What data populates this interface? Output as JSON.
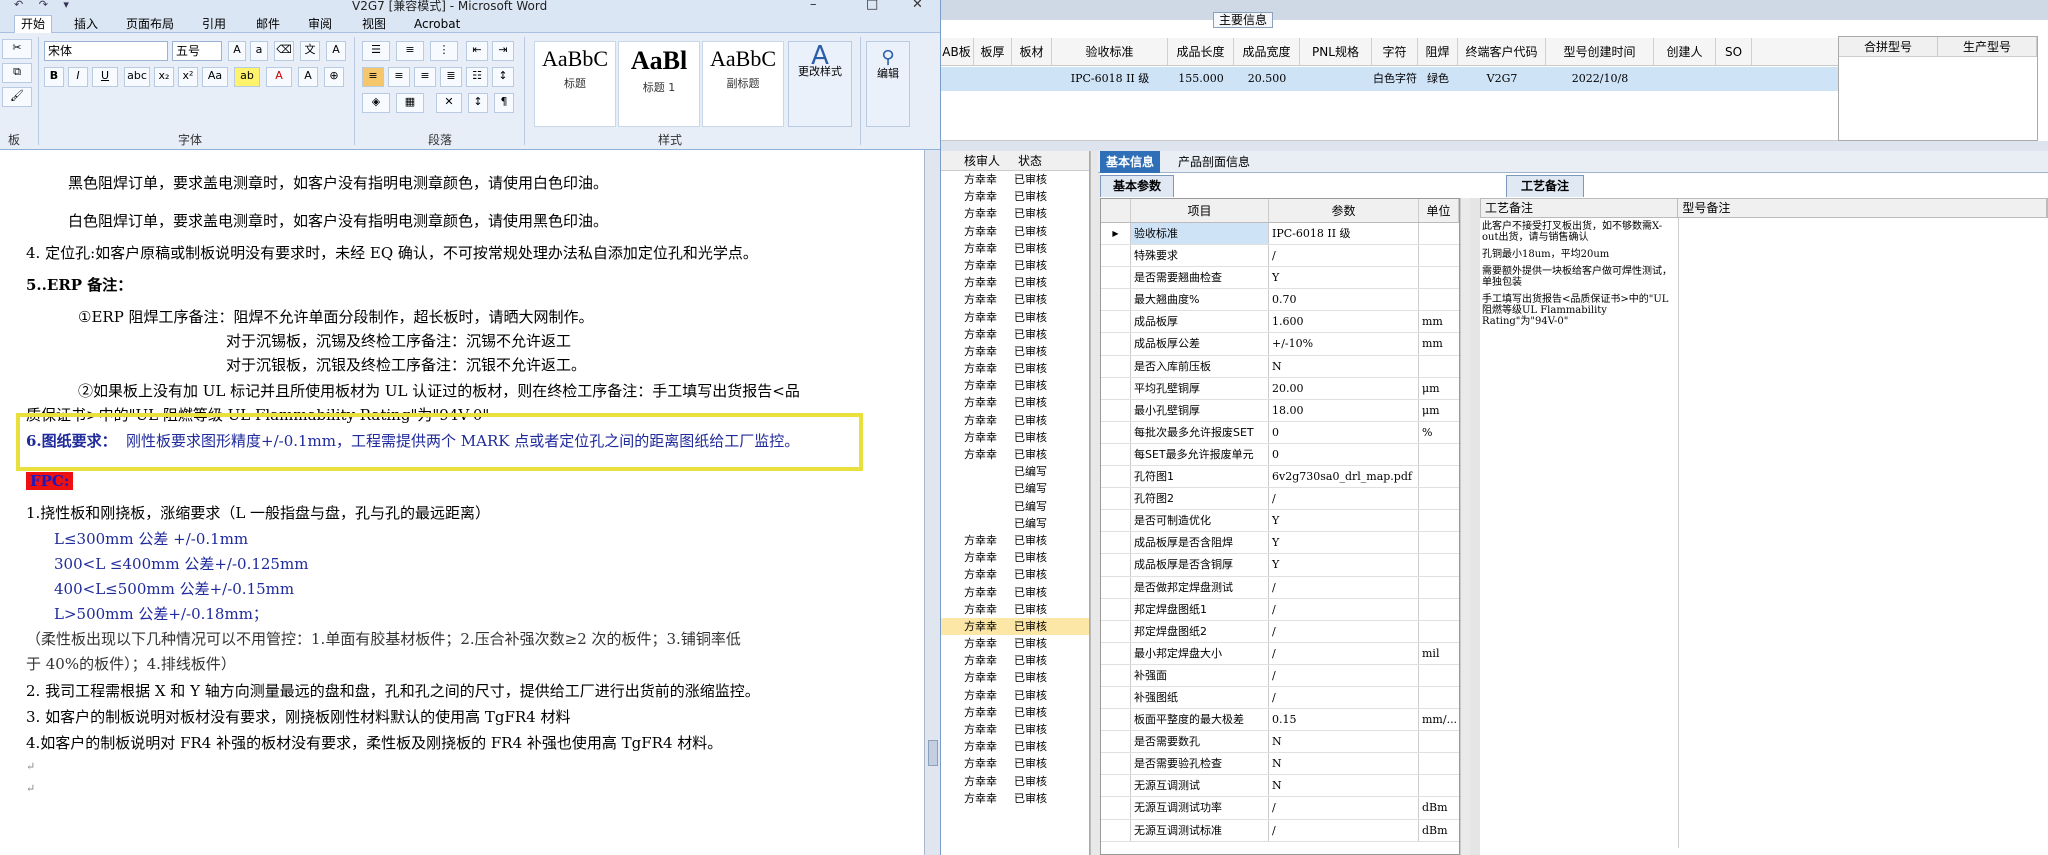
{
  "word": {
    "title": "V2G7 [兼容模式] - Microsoft Word",
    "quick_access": "↶ ↷ ▾",
    "window_controls": [
      "–",
      "□",
      "✕"
    ],
    "tabs": [
      "开始",
      "插入",
      "页面布局",
      "引用",
      "邮件",
      "审阅",
      "视图",
      "Acrobat"
    ],
    "font_name": "宋体",
    "font_size": "五号",
    "groups": [
      "板",
      "字体",
      "段落",
      "样式"
    ],
    "styles": [
      {
        "sample": "AaBbC",
        "name": "标题"
      },
      {
        "sample": "AaBl",
        "name": "标题 1"
      },
      {
        "sample": "AaBbC",
        "name": "副标题"
      }
    ],
    "change_styles": "更改样式",
    "edit": "编辑",
    "lines": [
      "黑色阻焊订单，要求盖电测章时，如客户没有指明电测章颜色，请使用白色印油。",
      "白色阻焊订单，要求盖电测章时，如客户没有指明电测章颜色，请使用黑色印油。",
      "4.  定位孔:如客户原稿或制板说明没有要求时，未经 EQ 确认，不可按常规处理办法私自添加定位孔和光学点。",
      "5..ERP 备注：",
      "①ERP 阻焊工序备注：阻焊不允许单面分段制作，超长板时，请晒大网制作。",
      "对于沉锡板，沉锡及终检工序备注：沉锡不允许返工",
      "对于沉银板，沉银及终检工序备注：沉银不允许返工。",
      "②如果板上没有加 UL 标记并且所使用板材为 UL 认证过的板材，则在终检工序备注：手工填写出货报告<品",
      "质保证书>中的\"UL 阻燃等级 UL Flammability Rating\"为\"94V-0\"",
      "6.图纸要求：",
      "刚性板要求图形精度+/-0.1mm，工程需提供两个 MARK 点或者定位孔之间的距离图纸给工厂监控。",
      "FPC:",
      "1.挠性板和刚挠板，涨缩要求（L 一般指盘与盘，孔与孔的最远距离）",
      "L≤300mm 公差 +/-0.1mm",
      "300<L ≤400mm 公差+/-0.125mm",
      "400<L≤500mm 公差+/-0.15mm",
      "L>500mm 公差+/-0.18mm；",
      "（柔性板出现以下几种情况可以不用管控：1.单面有胶基材板件；2.压合补强次数≥2 次的板件；3.铺铜率低",
      "于 40%的板件）；4.排线板件）",
      "2.   我司工程需根据 X 和 Y 轴方向测量最远的盘和盘，孔和孔之间的尺寸，提供给工厂进行出货前的涨缩监控。",
      "3. 如客户的制板说明对板材没有要求，刚挠板刚性材料默认的使用高 TgFR4 材料",
      "4.如客户的制板说明对 FR4 补强的板材没有要求，柔性板及刚挠板的 FR4 补强也使用高 TgFR4 材料。"
    ],
    "para_mark": "↵"
  },
  "erp": {
    "main_info": "主要信息",
    "grid_cols": [
      "AB板",
      "板厚",
      "板材",
      "验收标准",
      "成品长度",
      "成品宽度",
      "PNL规格",
      "字符",
      "阻焊",
      "终端客户代码",
      "型号创建时间",
      "创建人",
      "SO"
    ],
    "grid_row": [
      "",
      "",
      "",
      "IPC-6018 II 级",
      "155.000",
      "20.500",
      "",
      "白色字符",
      "绿色",
      "V2G7",
      "2022/10/8",
      "",
      ""
    ],
    "side_cols": [
      "合拼型号",
      "生产型号"
    ],
    "list_cols": [
      "核审人",
      "状态"
    ],
    "list_rows": [
      [
        "方幸幸",
        "已审核"
      ],
      [
        "方幸幸",
        "已审核"
      ],
      [
        "方幸幸",
        "已审核"
      ],
      [
        "方幸幸",
        "已审核"
      ],
      [
        "方幸幸",
        "已审核"
      ],
      [
        "方幸幸",
        "已审核"
      ],
      [
        "方幸幸",
        "已审核"
      ],
      [
        "方幸幸",
        "已审核"
      ],
      [
        "方幸幸",
        "已审核"
      ],
      [
        "方幸幸",
        "已审核"
      ],
      [
        "方幸幸",
        "已审核"
      ],
      [
        "方幸幸",
        "已审核"
      ],
      [
        "方幸幸",
        "已审核"
      ],
      [
        "方幸幸",
        "已审核"
      ],
      [
        "方幸幸",
        "已审核"
      ],
      [
        "方幸幸",
        "已审核"
      ],
      [
        "方幸幸",
        "已审核"
      ],
      [
        "",
        "已编写"
      ],
      [
        "",
        "已编写"
      ],
      [
        "",
        "已编写"
      ],
      [
        "",
        "已编写"
      ],
      [
        "方幸幸",
        "已审核"
      ],
      [
        "方幸幸",
        "已审核"
      ],
      [
        "方幸幸",
        "已审核"
      ],
      [
        "方幸幸",
        "已审核"
      ],
      [
        "方幸幸",
        "已审核"
      ],
      [
        "方幸幸",
        "已审核"
      ],
      [
        "方幸幸",
        "已审核"
      ],
      [
        "方幸幸",
        "已审核"
      ],
      [
        "方幸幸",
        "已审核"
      ],
      [
        "方幸幸",
        "已审核"
      ],
      [
        "方幸幸",
        "已审核"
      ],
      [
        "方幸幸",
        "已审核"
      ],
      [
        "方幸幸",
        "已审核"
      ],
      [
        "方幸幸",
        "已审核"
      ],
      [
        "方幸幸",
        "已审核"
      ],
      [
        "方幸幸",
        "已审核"
      ]
    ],
    "tabs": [
      "基本信息",
      "产品剖面信息"
    ],
    "subtab": "基本参数",
    "param_cols": [
      "项目",
      "参数",
      "单位"
    ],
    "params": [
      [
        "验收标准",
        "IPC-6018 II 级",
        ""
      ],
      [
        "特殊要求",
        "/",
        ""
      ],
      [
        "是否需要翘曲检查",
        "Y",
        ""
      ],
      [
        "最大翘曲度%",
        "0.70",
        ""
      ],
      [
        "成品板厚",
        "1.600",
        "mm"
      ],
      [
        "成品板厚公差",
        "+/-10%",
        "mm"
      ],
      [
        "是否入库前压板",
        "N",
        ""
      ],
      [
        "平均孔壁铜厚",
        "20.00",
        "μm"
      ],
      [
        "最小孔壁铜厚",
        "18.00",
        "μm"
      ],
      [
        "每批次最多允许报废SET",
        "0",
        "%"
      ],
      [
        "每SET最多允许报废单元",
        "0",
        ""
      ],
      [
        "孔符图1",
        "6v2g730sa0_drl_map.pdf",
        ""
      ],
      [
        "孔符图2",
        "/",
        ""
      ],
      [
        "是否可制造优化",
        "Y",
        ""
      ],
      [
        "成品板厚是否含阻焊",
        "Y",
        ""
      ],
      [
        "成品板厚是否含铜厚",
        "Y",
        ""
      ],
      [
        "是否做邦定焊盘测试",
        "/",
        ""
      ],
      [
        "邦定焊盘图纸1",
        "/",
        ""
      ],
      [
        "邦定焊盘图纸2",
        "/",
        ""
      ],
      [
        "最小邦定焊盘大小",
        "/",
        "mil"
      ],
      [
        "补强面",
        "/",
        ""
      ],
      [
        "补强图纸",
        "/",
        ""
      ],
      [
        "板面平整度的最大极差",
        "0.15",
        "mm/..."
      ],
      [
        "是否需要数孔",
        "N",
        ""
      ],
      [
        "是否需要验孔检查",
        "N",
        ""
      ],
      [
        "无源互调测试",
        "N",
        ""
      ],
      [
        "无源互调测试功率",
        "/",
        "dBm"
      ],
      [
        "无源互调测试标准",
        "/",
        "dBm"
      ]
    ],
    "craft_tab": "工艺备注",
    "craft_cols": [
      "工艺备注",
      "型号备注"
    ],
    "craft_notes": [
      "此客户不接受打叉板出货，如不够数需X-out出货，请与销售确认",
      "孔铜最小18um，平均20um",
      "需要额外提供一块板给客户做可焊性测试，单独包装",
      "手工填写出货报告<品质保证书>中的\"UL阻燃等级UL Flammability Rating\"为\"94V-0\""
    ]
  }
}
